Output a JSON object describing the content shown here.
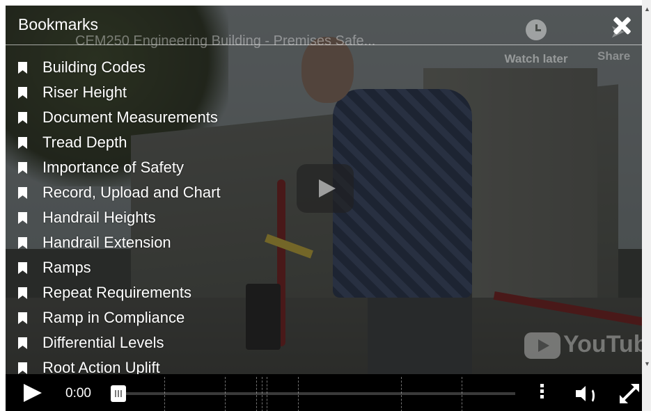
{
  "bookmarks": {
    "title": "Bookmarks",
    "items": [
      {
        "label": "Building Codes"
      },
      {
        "label": "Riser Height"
      },
      {
        "label": "Document Measurements"
      },
      {
        "label": "Tread Depth"
      },
      {
        "label": "Importance of Safety"
      },
      {
        "label": "Record, Upload and Chart"
      },
      {
        "label": "Handrail Heights"
      },
      {
        "label": "Handrail Extension"
      },
      {
        "label": "Ramps"
      },
      {
        "label": "Repeat Requirements"
      },
      {
        "label": "Ramp in Compliance"
      },
      {
        "label": "Differential Levels"
      },
      {
        "label": "Root Action Uplift"
      }
    ]
  },
  "video": {
    "title": "CEM250 Engineering Building - Premises Safe...",
    "watch_later": "Watch later",
    "share": "Share",
    "logo": "YouTube"
  },
  "controls": {
    "time": "0:00",
    "progress": 0
  },
  "colors": {
    "overlay_text": "#ffffff",
    "control_bar": "#000000",
    "handrail": "#7a1e1e"
  },
  "icons": [
    "bookmark-icon",
    "close-icon",
    "play-icon",
    "clock-icon",
    "share-icon",
    "more-vertical-icon",
    "volume-icon",
    "fullscreen-icon",
    "youtube-logo"
  ]
}
